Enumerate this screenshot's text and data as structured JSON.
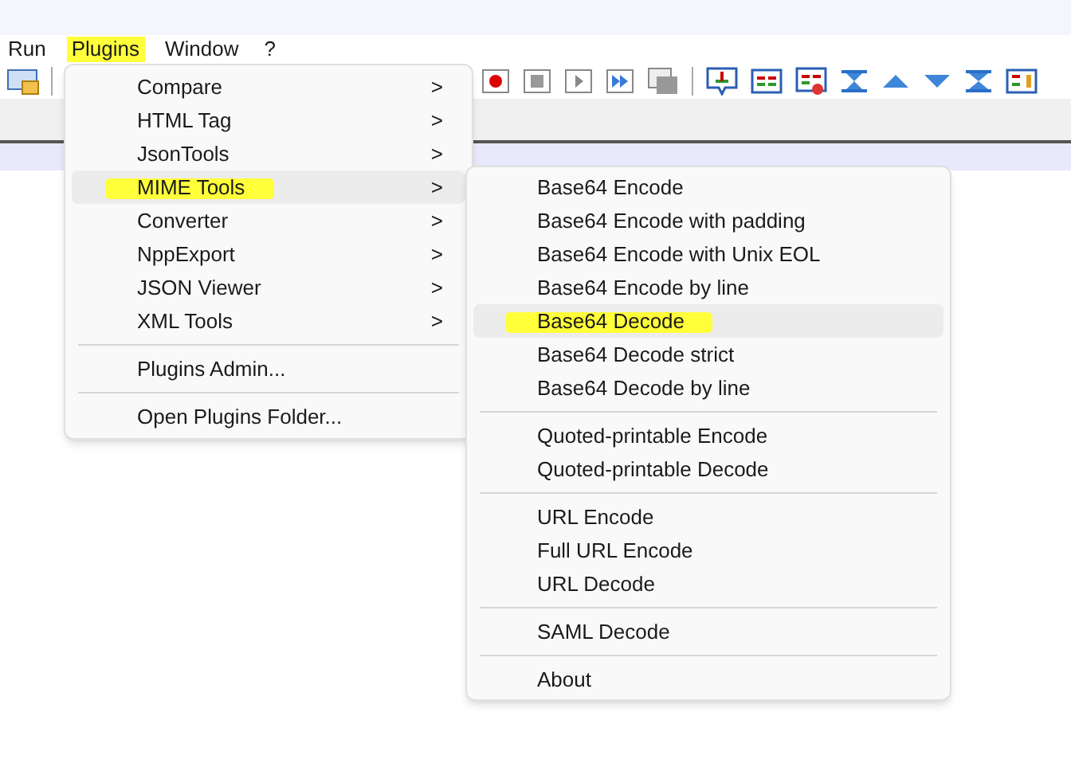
{
  "menu_bar": [
    {
      "label": "Run",
      "selected": false
    },
    {
      "label": "Plugins",
      "selected": true
    },
    {
      "label": "Window",
      "selected": false
    },
    {
      "label": "?",
      "selected": false
    }
  ],
  "plugins_menu": {
    "groups": [
      [
        {
          "label": "Compare",
          "submenu": true,
          "selected": false,
          "highlighted": false
        },
        {
          "label": "HTML Tag",
          "submenu": true,
          "selected": false,
          "highlighted": false
        },
        {
          "label": "JsonTools",
          "submenu": true,
          "selected": false,
          "highlighted": false
        },
        {
          "label": "MIME Tools",
          "submenu": true,
          "selected": true,
          "highlighted": true
        },
        {
          "label": "Converter",
          "submenu": true,
          "selected": false,
          "highlighted": false
        },
        {
          "label": "NppExport",
          "submenu": true,
          "selected": false,
          "highlighted": false
        },
        {
          "label": "JSON Viewer",
          "submenu": true,
          "selected": false,
          "highlighted": false
        },
        {
          "label": "XML Tools",
          "submenu": true,
          "selected": false,
          "highlighted": false
        }
      ],
      [
        {
          "label": "Plugins Admin...",
          "submenu": false,
          "selected": false,
          "highlighted": false
        }
      ],
      [
        {
          "label": "Open Plugins Folder...",
          "submenu": false,
          "selected": false,
          "highlighted": false
        }
      ]
    ],
    "submenu_arrow": ">"
  },
  "mime_tools_menu": {
    "groups": [
      [
        {
          "label": "Base64 Encode",
          "selected": false,
          "highlighted": false
        },
        {
          "label": "Base64 Encode with padding",
          "selected": false,
          "highlighted": false
        },
        {
          "label": "Base64 Encode with Unix EOL",
          "selected": false,
          "highlighted": false
        },
        {
          "label": "Base64 Encode by line",
          "selected": false,
          "highlighted": false
        },
        {
          "label": "Base64 Decode",
          "selected": true,
          "highlighted": true
        },
        {
          "label": "Base64 Decode strict",
          "selected": false,
          "highlighted": false
        },
        {
          "label": "Base64 Decode by line",
          "selected": false,
          "highlighted": false
        }
      ],
      [
        {
          "label": "Quoted-printable Encode",
          "selected": false,
          "highlighted": false
        },
        {
          "label": "Quoted-printable Decode",
          "selected": false,
          "highlighted": false
        }
      ],
      [
        {
          "label": "URL Encode",
          "selected": false,
          "highlighted": false
        },
        {
          "label": "Full URL Encode",
          "selected": false,
          "highlighted": false
        },
        {
          "label": "URL Decode",
          "selected": false,
          "highlighted": false
        }
      ],
      [
        {
          "label": "SAML Decode",
          "selected": false,
          "highlighted": false
        }
      ],
      [
        {
          "label": "About",
          "selected": false,
          "highlighted": false
        }
      ]
    ]
  }
}
